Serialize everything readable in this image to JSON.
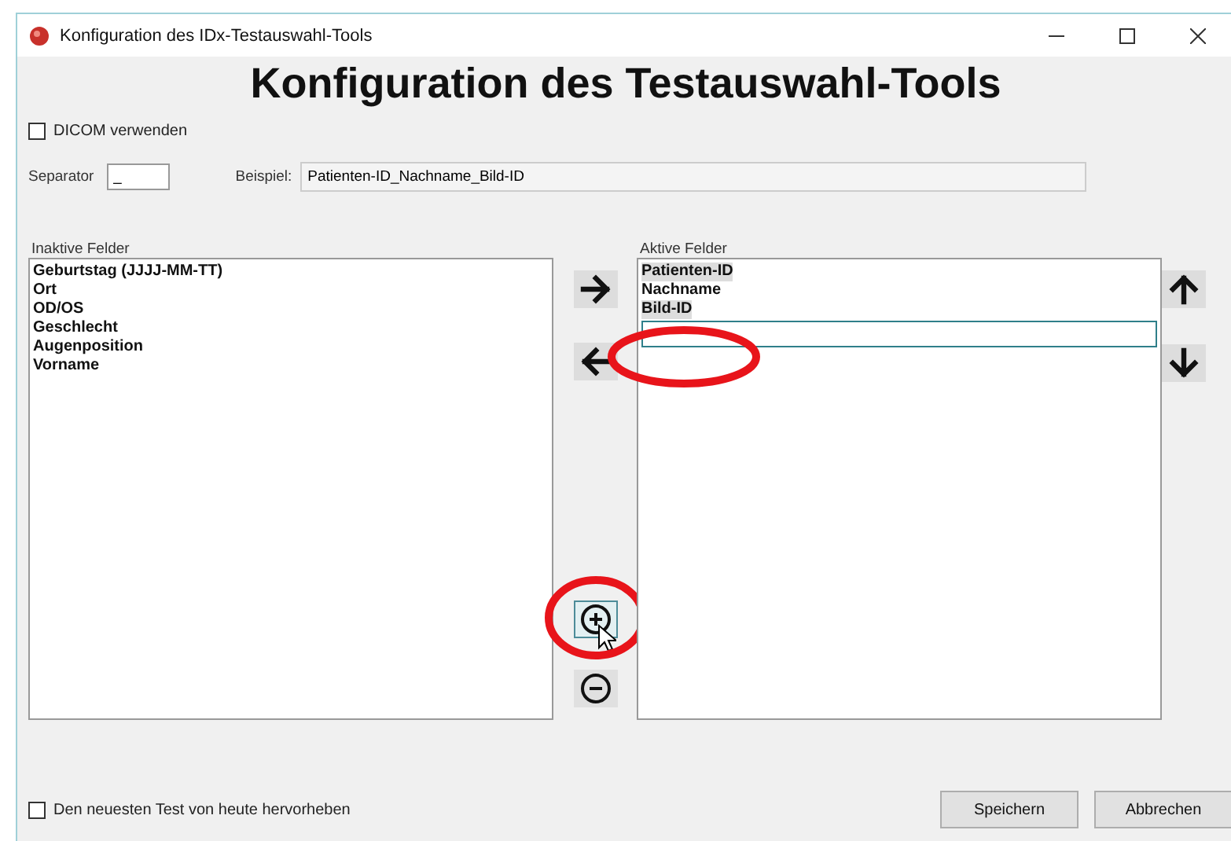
{
  "window": {
    "title": "Konfiguration des IDx-Testauswahl-Tools"
  },
  "heading": "Konfiguration des Testauswahl-Tools",
  "dicom": {
    "label": "DICOM verwenden",
    "checked": false
  },
  "separator": {
    "label": "Separator",
    "value": "_"
  },
  "example": {
    "label": "Beispiel:",
    "value": "Patienten-ID_Nachname_Bild-ID"
  },
  "inactive": {
    "label": "Inaktive Felder",
    "items": [
      {
        "label": "Geburtstag (JJJJ-MM-TT)"
      },
      {
        "label": "Ort"
      },
      {
        "label": "OD/OS"
      },
      {
        "label": "Geschlecht"
      },
      {
        "label": "Augenposition"
      },
      {
        "label": "Vorname"
      }
    ]
  },
  "active": {
    "label": "Aktive Felder",
    "items": [
      {
        "label": "Patienten-ID",
        "selected": true
      },
      {
        "label": "Nachname",
        "selected": false
      },
      {
        "label": "Bild-ID",
        "selected": true
      }
    ]
  },
  "highlight": {
    "label": "Den neuesten Test von heute hervorheben",
    "checked": false
  },
  "buttons": [
    "Speichern",
    "Abbrechen"
  ]
}
